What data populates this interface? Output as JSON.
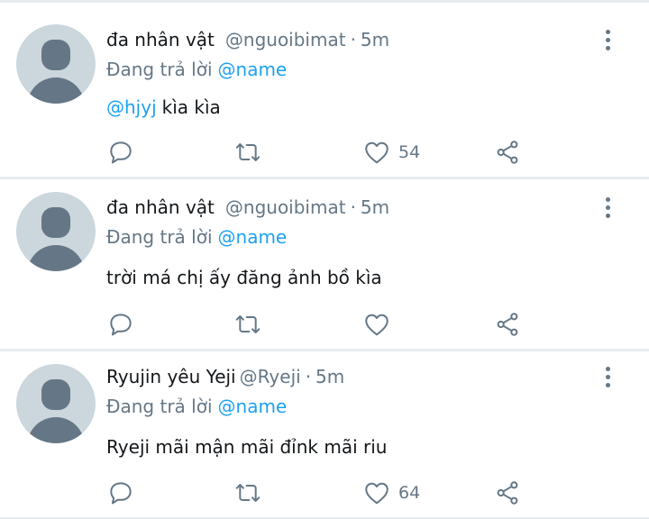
{
  "tweets": [
    {
      "author_name": "đa nhân vật",
      "handle": "@nguoibimat",
      "separator": "·",
      "time": "5m",
      "replying_prefix": "Đang trả lời",
      "replying_to": "@name",
      "text_mention": "@hjyj",
      "text": "kìa kìa",
      "like_count": "54"
    },
    {
      "author_name": "đa nhân vật",
      "handle": "@nguoibimat",
      "separator": "·",
      "time": "5m",
      "replying_prefix": "Đang trả lời",
      "replying_to": "@name",
      "text_mention": "",
      "text": "trời má chị ấy đăng ảnh bồ kìa",
      "like_count": ""
    },
    {
      "author_name": "Ryujin yêu Yeji",
      "handle": "@Ryeji",
      "separator": "·",
      "time": "5m",
      "replying_prefix": "Đang trả lời",
      "replying_to": "@name",
      "text_mention": "",
      "text": "Ryeji mãi mận mãi đỉnk mãi riu",
      "like_count": "64"
    }
  ],
  "icons": {
    "reply": "reply-icon",
    "retweet": "retweet-icon",
    "like": "heart-icon",
    "share": "share-icon",
    "more": "more-vertical-icon"
  },
  "colors": {
    "mention": "#1da1f2",
    "secondary_text": "#657786",
    "avatar_bg": "#ccd6dd",
    "divider": "#e6ecf0"
  }
}
